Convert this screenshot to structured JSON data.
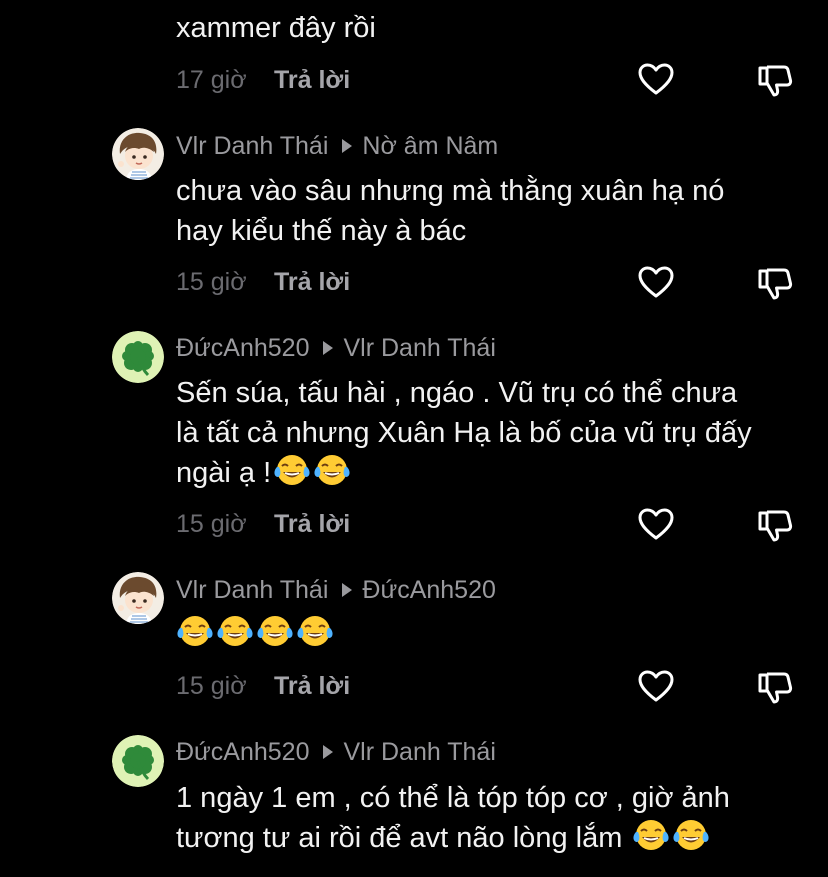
{
  "comments": [
    {
      "body": "xammer đây rồi",
      "time": "17 giờ",
      "reply_label": "Trả lời",
      "emojis": 0
    },
    {
      "author": "Vlr Danh Thái",
      "reply_to": "Nờ âm Nâm",
      "avatar": "boy-avatar",
      "body_lines": [
        "chưa vào sâu nhưng mà thằng xuân hạ nó",
        "hay kiểu thế này à bác"
      ],
      "time": "15 giờ",
      "reply_label": "Trả lời",
      "emojis": 0
    },
    {
      "author": "ĐứcAnh520",
      "reply_to": "Vlr Danh Thái",
      "avatar": "clover-avatar",
      "body_lines": [
        "Sến súa, tấu hài , ngáo . Vũ trụ có thể chưa",
        "là tất cả nhưng Xuân Hạ là bố của vũ trụ đấy",
        "ngài ạ !"
      ],
      "time": "15 giờ",
      "reply_label": "Trả lời",
      "emojis": 2,
      "emoji_name": "face-with-tears-of-joy"
    },
    {
      "author": "Vlr Danh Thái",
      "reply_to": "ĐứcAnh520",
      "avatar": "boy-avatar",
      "body_lines": [
        ""
      ],
      "time": "15 giờ",
      "reply_label": "Trả lời",
      "emojis": 4,
      "emoji_name": "face-with-tears-of-joy"
    },
    {
      "author": "ĐứcAnh520",
      "reply_to": "Vlr Danh Thái",
      "avatar": "clover-avatar",
      "body_lines": [
        "1 ngày 1 em , có thể là tóp tóp cơ , giờ ảnh",
        "tương tư ai rồi để avt não lòng lắm"
      ],
      "emojis": 2,
      "emoji_name": "face-with-tears-of-joy"
    }
  ],
  "icons": {
    "like": "heart-outline-icon",
    "dislike": "thumbs-down-outline-icon"
  },
  "colors": {
    "background": "#000000",
    "username": "#9a9a9e",
    "body_text": "#f2f2f2",
    "timestamp": "#6b6b70",
    "reply": "#a5a5aa"
  }
}
